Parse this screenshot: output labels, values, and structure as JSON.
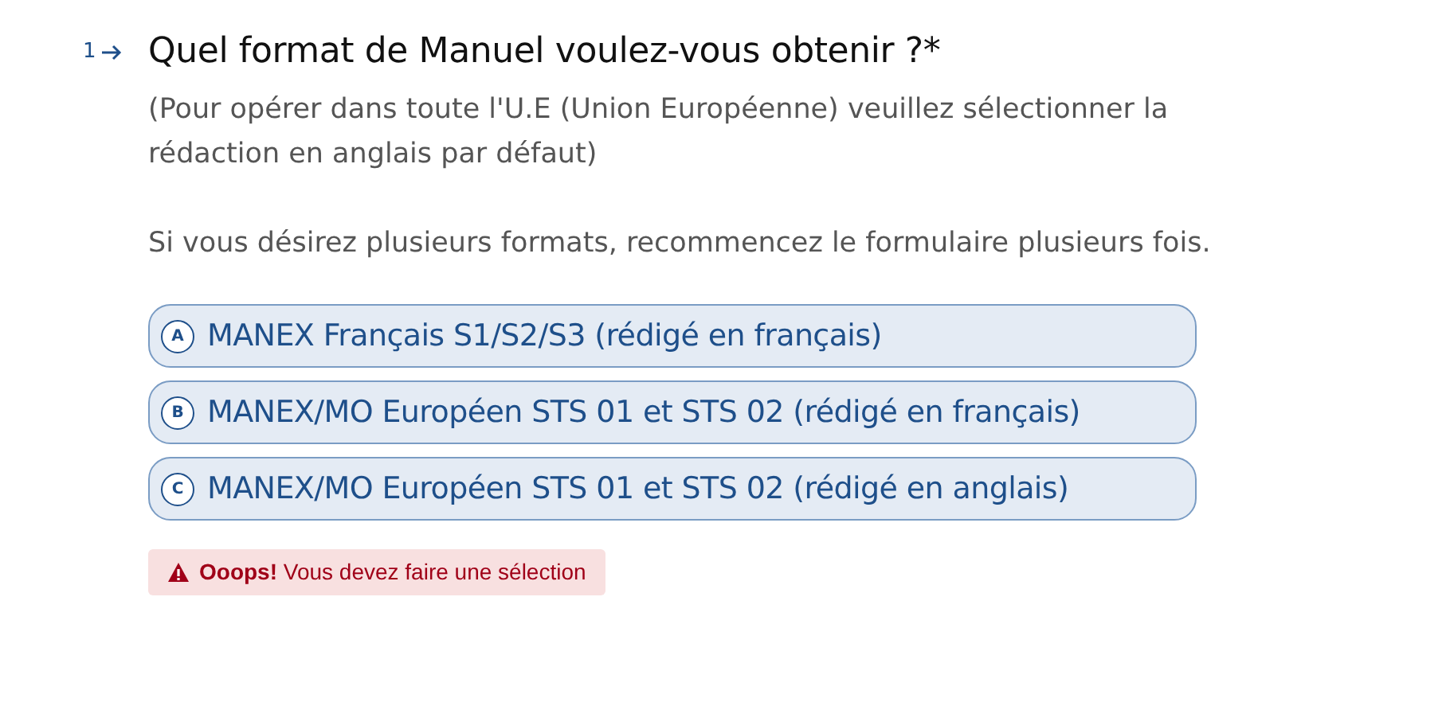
{
  "question": {
    "number": "1",
    "title": "Quel format de Manuel voulez-vous obtenir ?*",
    "description": [
      "(Pour opérer dans toute l'U.E (Union Européenne) veuillez sélectionner la rédaction en anglais par défaut)",
      "Si vous désirez plusieurs formats, recommencez le formulaire plusieurs fois."
    ]
  },
  "choices": [
    {
      "key": "A",
      "label": "MANEX Français S1/S2/S3 (rédigé en français)",
      "selected": false
    },
    {
      "key": "B",
      "label": "MANEX/MO Européen STS 01 et STS 02 (rédigé en français)",
      "selected": false
    },
    {
      "key": "C",
      "label": "MANEX/MO Européen STS 01 et STS 02 (rédigé en anglais)",
      "selected": false
    }
  ],
  "error": {
    "message": "**Ooops!** Vous devez faire une sélection"
  }
}
